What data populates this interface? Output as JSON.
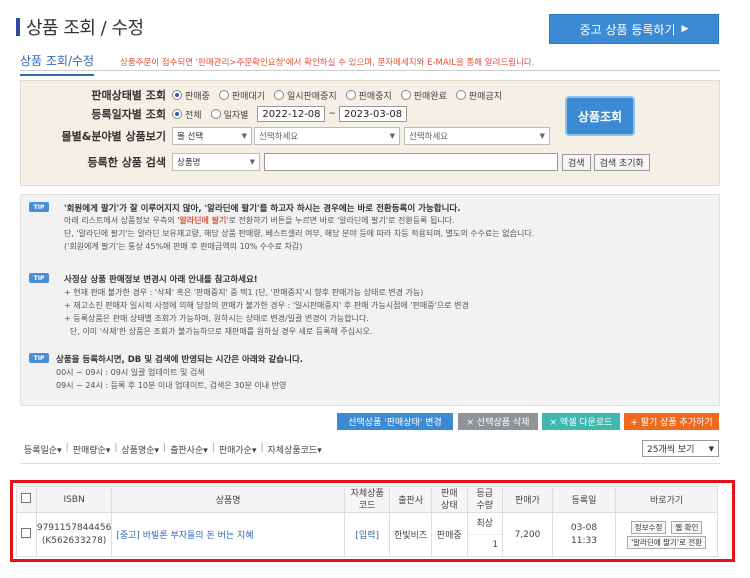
{
  "header": {
    "title": "상품 조회 / 수정",
    "register_button": "중고 상품 등록하기",
    "subtab": "상품 조회/수정",
    "notice": "상품주문이 접수되면 '판매관리>주문확인요청'에서 확인하실 수 있으며, 문자메세지와 E-MAIL을 통해 알려드립니다."
  },
  "search": {
    "status_label": "판매상태별 조회",
    "status_options": [
      "판매중",
      "판매대기",
      "일시판매중지",
      "판매중지",
      "판매완료",
      "판매금지"
    ],
    "status_selected": "판매중",
    "date_label": "등록일자별 조회",
    "date_options": [
      "전체",
      "일자별"
    ],
    "date_selected": "전체",
    "date_from": "2022-12-08",
    "date_sep": "~",
    "date_to": "2023-03-08",
    "mall_label": "몰별&분야별 상품보기",
    "mall_select": "몰 선택",
    "category1": "선택하세요",
    "category2": "선택하세요",
    "keyword_label": "등록한 상품 검색",
    "keyword_type": "상품명",
    "keyword_value": "",
    "search_button": "검색",
    "reset_button": "검색 초기화",
    "query_button": "상품조회"
  },
  "tips": {
    "badge": "TIP",
    "tip1": {
      "head": "'회원에게 팔기'가 잘 이루어지지 않아, '알라딘에 팔기'를 하고자 하시는 경우에는 바로 전환등록이 가능합니다.",
      "l1a": "아래 리스트에서 상품정보 우측의 '",
      "l1b": "알라딘에 팔기",
      "l1c": "'로 전환하기 버튼을 누르면 바로 '알라딘에 팔기'로 전환등록 됩니다.",
      "l2": "단, '알라딘에 팔기'는 알라딘 보유재고량, 해당 상품 판매량, 베스트셀러 여부, 해당 분야 등에 따라 차등 적용되며, 별도의 수수료는 없습니다.",
      "l3": "('회원에게 팔기'는 통상 45%에 판매 후 판매금액의 10% 수수료 차감)"
    },
    "tip2": {
      "head": "사정상 상품 판매정보 변경시 아래 안내를 참고하세요!",
      "l1": "+ 현재 판매 불가한 경우 : '삭제' 혹은 '판매중지' 중 택1 (단, '판매중지'시 향후 판매가능 상태로 변경 가능)",
      "l2": "+ 재고소진 판매자 일시적 사정에 의해 당장의 판매가 불가한 경우 : '일시판매중지' 후 판매 가능시점에 '판매중'으로 변경",
      "l3": "+ 등록상품은 판매 상태별 조회가 가능하며, 원하시는 상태로 변경/일괄 변경이 가능합니다.",
      "l4": "단, 이미 '삭제'한 상품은 조회가 불가능하므로 재판매를 원하실 경우 새로 등록해 주십시오."
    },
    "tip3": {
      "head": "상품을 등록하시면, DB 및 검색에 반영되는 시간은 아래와 같습니다.",
      "l1": "00시 ~ 09시 : 09시 일괄 업데이트 및 검색",
      "l2": "09시 ~ 24시 : 등록 후 10분 이내 업데이트, 검색은 30분 이내 반영"
    }
  },
  "actions": {
    "change_status": "선택상품 '판매상태' 변경",
    "delete": "× 선택상품 삭제",
    "excel": "× 엑셀 다운로드",
    "add": "+ 팔기 상품 추가하기"
  },
  "sort": {
    "items": [
      "등록일순",
      "판매량순",
      "상품명순",
      "출판사순",
      "판매가순",
      "자체상품코드"
    ],
    "per_page": "25개씩 보기"
  },
  "table": {
    "headers": {
      "isbn": "ISBN",
      "name": "상품명",
      "code": "자체상품\n코드",
      "publisher": "출판사",
      "status": "판매\n상태",
      "grade_qty": "등급\n수량",
      "price": "판매가",
      "date": "등록일",
      "shortcut": "바로가기"
    },
    "rows": [
      {
        "isbn": "9791157844456",
        "isbn_sub": "(K562633278)",
        "name": "[중고] 바빌론 부자들의 돈 버는 지혜",
        "code": "[입력]",
        "publisher": "한빛비즈",
        "status": "판매중",
        "grade": "최상",
        "qty": "1",
        "price": "7,200",
        "date": "03-08",
        "time": "11:33",
        "btn_edit": "정보수정",
        "btn_web": "웹 확인",
        "btn_convert": "'알라딘에 팔기'로 전환"
      }
    ]
  },
  "colors": {
    "accent": "#3b8ad3",
    "highlight": "#e0533b",
    "frame": "#e5101a"
  }
}
